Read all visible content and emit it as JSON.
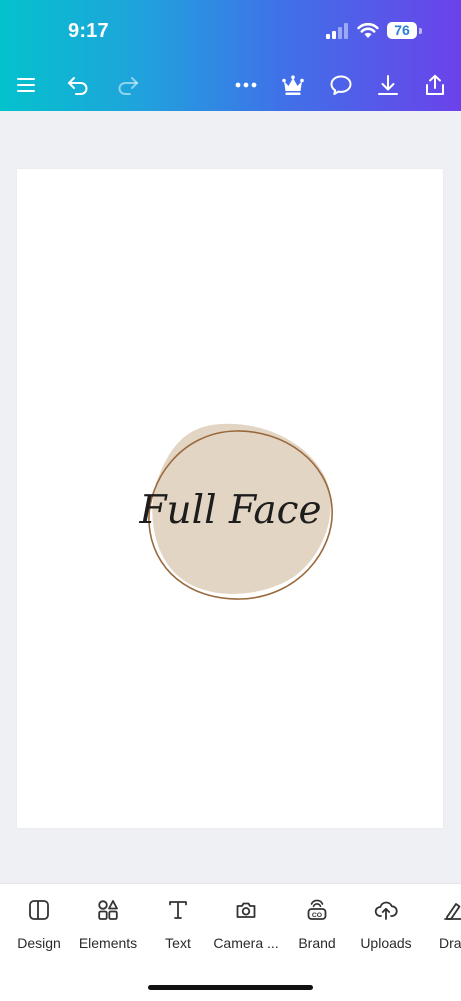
{
  "status_bar": {
    "time": "9:17",
    "battery": "76"
  },
  "toolbar": {
    "menu_icon": "menu-icon",
    "undo_icon": "undo-icon",
    "redo_icon": "redo-icon",
    "more_icon": "more-icon",
    "premium_icon": "crown-icon",
    "comment_icon": "comment-icon",
    "download_icon": "download-icon",
    "share_icon": "share-icon"
  },
  "design": {
    "logo_text": "Full Face",
    "blob_color": "#e3d5c4",
    "ring_color": "#9a6a3e"
  },
  "bottom_nav": {
    "items": [
      {
        "label": "Design",
        "icon": "design-icon"
      },
      {
        "label": "Elements",
        "icon": "elements-icon"
      },
      {
        "label": "Text",
        "icon": "text-icon"
      },
      {
        "label": "Camera ...",
        "icon": "camera-icon"
      },
      {
        "label": "Brand",
        "icon": "brand-icon"
      },
      {
        "label": "Uploads",
        "icon": "uploads-icon"
      },
      {
        "label": "Dra",
        "icon": "draw-icon"
      }
    ]
  }
}
